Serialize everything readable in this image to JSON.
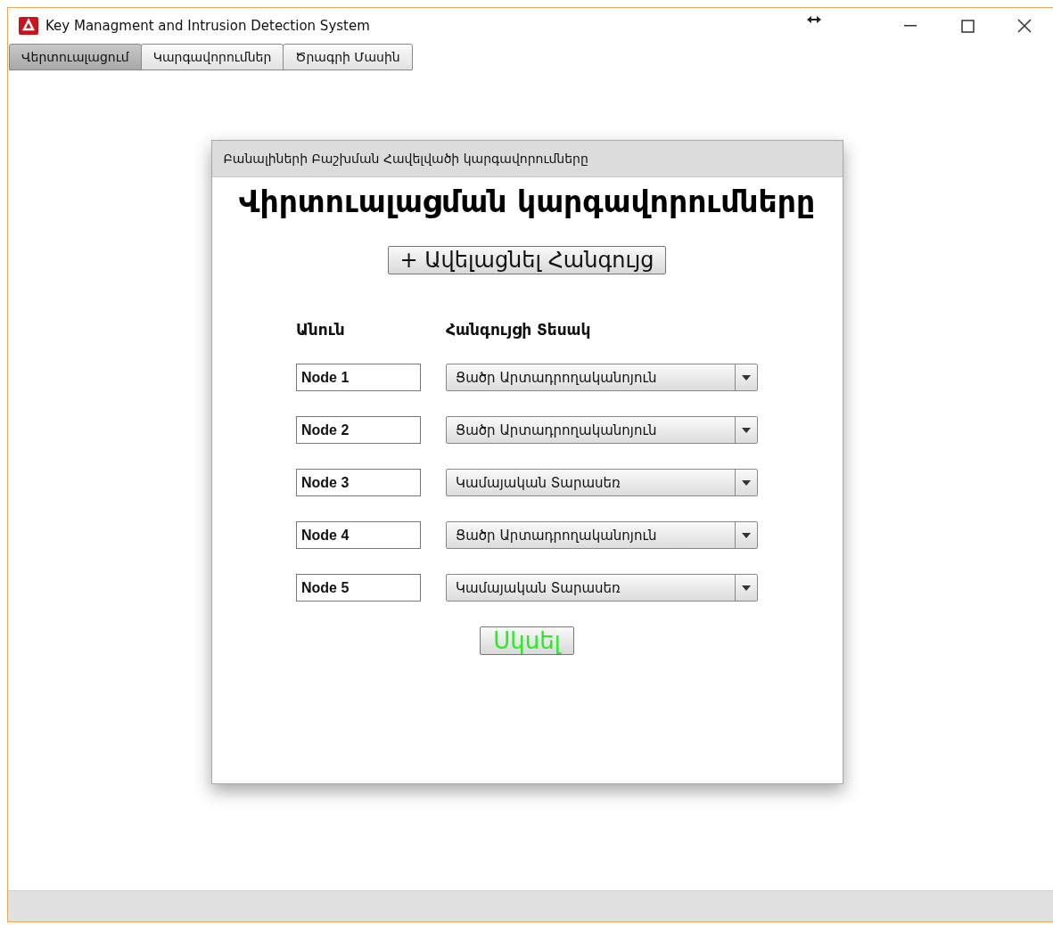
{
  "window": {
    "title": "Key Managment and Intrusion Detection System"
  },
  "tabs": [
    {
      "label": "Վերտուալացում",
      "selected": true
    },
    {
      "label": "Կարգավորումներ",
      "selected": false
    },
    {
      "label": "Ծրագրի Մասին",
      "selected": false
    }
  ],
  "panel": {
    "header": "Բանալիների Բաշխման Հավելվածի կարգավորումները",
    "title": "Վիրտուալացման կարգավորումները",
    "add_button": "+ Ավելացնել Հանգույց",
    "columns": [
      "Անուն",
      "Հանգույցի Տեսակ"
    ],
    "rows": [
      {
        "name": "Node 1",
        "type": "Ցածր Արտադրողականոյուն"
      },
      {
        "name": "Node 2",
        "type": "Ցածր Արտադրողականոյուն"
      },
      {
        "name": "Node 3",
        "type": "Կամայական Տարասեռ"
      },
      {
        "name": "Node 4",
        "type": "Ցածր Արտադրողականոյուն"
      },
      {
        "name": "Node 5",
        "type": "Կամայական Տարասեռ"
      }
    ],
    "start_button": "Սկսել"
  }
}
